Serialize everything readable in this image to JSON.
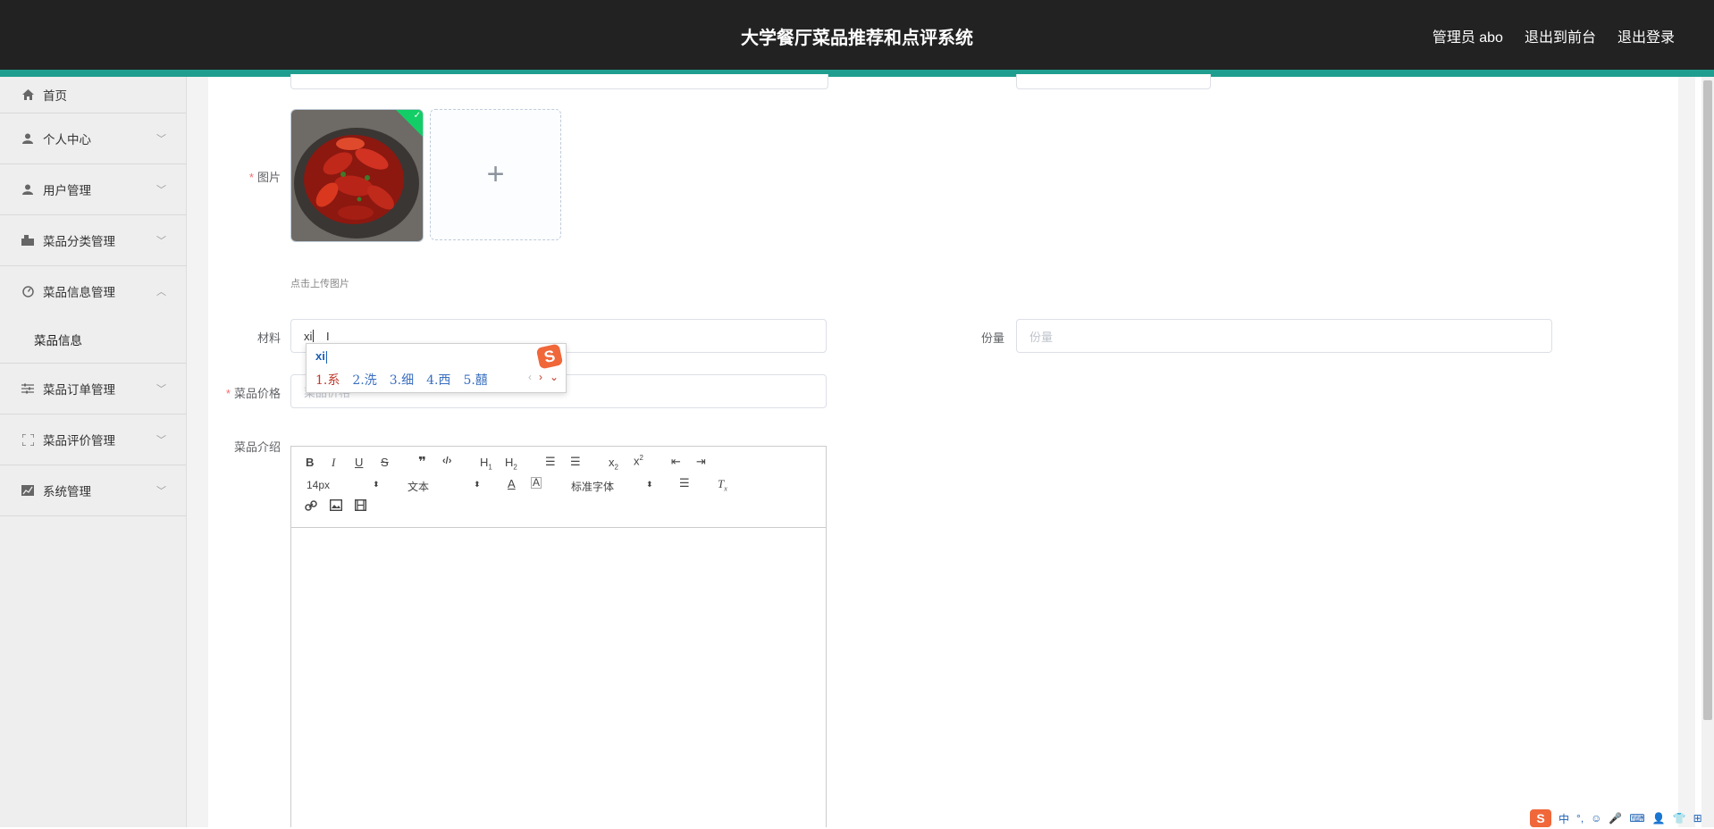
{
  "header": {
    "title": "大学餐厅菜品推荐和点评系统",
    "links": [
      "管理员 abo",
      "退出到前台",
      "退出登录"
    ]
  },
  "sidebar": {
    "items": [
      {
        "label": "首页",
        "icon": "home-icon"
      },
      {
        "label": "个人中心",
        "icon": "user-icon"
      },
      {
        "label": "用户管理",
        "icon": "user-icon"
      },
      {
        "label": "菜品分类管理",
        "icon": "category-icon"
      },
      {
        "label": "菜品信息管理",
        "icon": "dashboard-icon",
        "expanded": true,
        "children": [
          "菜品信息"
        ]
      },
      {
        "label": "菜品订单管理",
        "icon": "sliders-icon"
      },
      {
        "label": "菜品评价管理",
        "icon": "fullscreen-icon"
      },
      {
        "label": "系统管理",
        "icon": "chart-icon"
      }
    ]
  },
  "form": {
    "image_label": "图片",
    "upload_hint": "点击上传图片",
    "material_label": "材料",
    "material_value": "xi",
    "portion_label": "份量",
    "portion_placeholder": "份量",
    "price_label": "菜品价格",
    "price_placeholder": "菜品价格",
    "intro_label": "菜品介绍"
  },
  "ime": {
    "composition": "xi",
    "candidates": [
      "1.系",
      "2.洗",
      "3.细",
      "4.西",
      "5.囍"
    ],
    "logo": "S"
  },
  "editor": {
    "font_size": "14px",
    "header_format": "文本",
    "font_family": "标准字体"
  },
  "tray": {
    "logo": "S",
    "items": [
      "中",
      "°,",
      "☺",
      "🎤",
      "⌨",
      "👤",
      "👕",
      "⊞"
    ]
  },
  "colors": {
    "topbar": "#222222",
    "accent": "#1f9e8f",
    "required": "#f56c6c",
    "success": "#13ce66"
  }
}
